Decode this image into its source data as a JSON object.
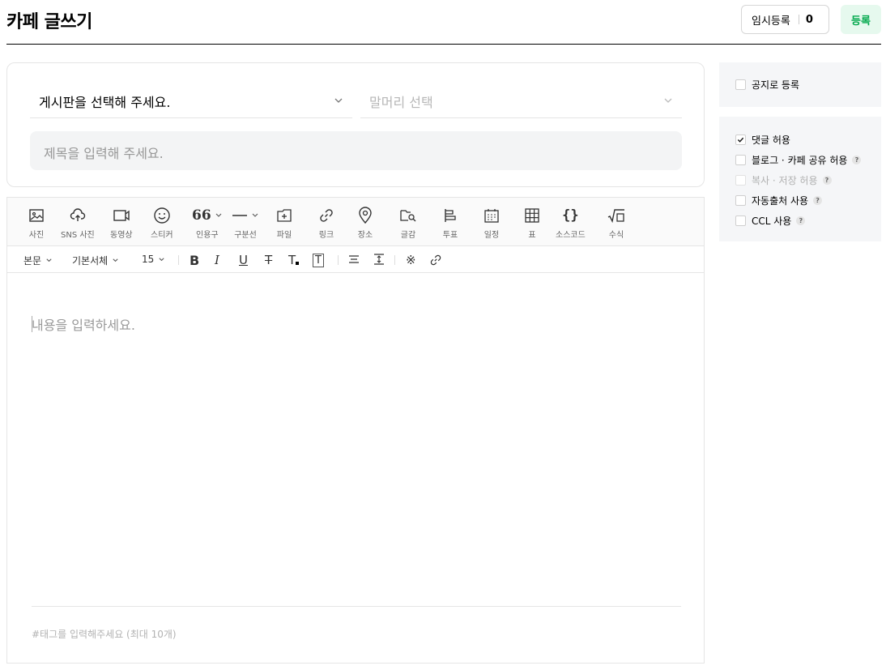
{
  "header": {
    "title": "카페 글쓰기",
    "temp_save_label": "임시등록",
    "temp_save_count": "0",
    "register_label": "등록"
  },
  "form": {
    "board_select": "게시판을 선택해 주세요.",
    "head_select": "말머리 선택",
    "title_placeholder": "제목을 입력해 주세요."
  },
  "toolbar": {
    "items": [
      {
        "label": "사진",
        "icon": "image-icon"
      },
      {
        "label": "SNS 사진",
        "icon": "cloud-upload-icon"
      },
      {
        "label": "동영상",
        "icon": "video-icon"
      },
      {
        "label": "스티커",
        "icon": "smiley-icon"
      },
      {
        "label": "인용구",
        "icon": "quote-icon"
      },
      {
        "label": "구분선",
        "icon": "divider-icon"
      },
      {
        "label": "파일",
        "icon": "file-add-icon"
      },
      {
        "label": "링크",
        "icon": "link-icon"
      },
      {
        "label": "장소",
        "icon": "map-pin-icon"
      },
      {
        "label": "글감",
        "icon": "search-material-icon"
      },
      {
        "label": "투표",
        "icon": "poll-icon"
      },
      {
        "label": "일정",
        "icon": "calendar-icon"
      },
      {
        "label": "표",
        "icon": "table-icon"
      },
      {
        "label": "소스코드",
        "icon": "code-braces-icon"
      },
      {
        "label": "수식",
        "icon": "formula-icon"
      }
    ]
  },
  "format_bar": {
    "paragraph": "본문",
    "font": "기본서체",
    "size": "15"
  },
  "editor": {
    "content_placeholder": "내용을 입력하세요.",
    "tag_placeholder": "#태그를 입력해주세요 (최대 10개)"
  },
  "options": {
    "notice": {
      "label": "공지로 등록",
      "checked": false
    },
    "comments": {
      "label": "댓글 허용",
      "checked": true
    },
    "share": {
      "label": "블로그 · 카페 공유 허용",
      "checked": false
    },
    "copy": {
      "label": "복사 · 저장 허용",
      "checked": false,
      "disabled": true
    },
    "source": {
      "label": "자동출처 사용",
      "checked": false
    },
    "ccl": {
      "label": "CCL 사용",
      "checked": false
    }
  },
  "colors": {
    "accent_green": "#03a94d",
    "register_bg": "#e6f9ee",
    "panel_bg": "#f5f6f8"
  }
}
